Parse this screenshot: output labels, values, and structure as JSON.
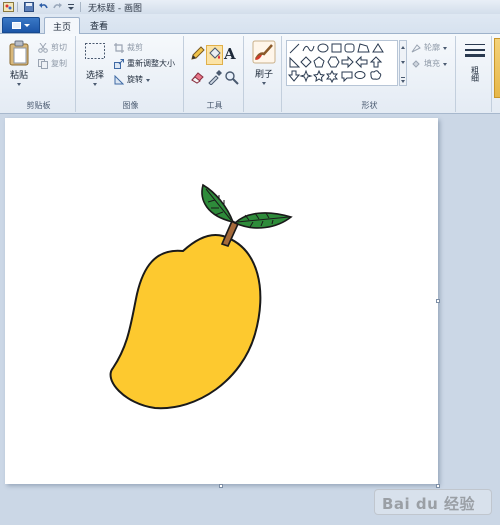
{
  "window": {
    "title": "无标题 - 画图"
  },
  "tabs": [
    {
      "label": "主页",
      "active": true
    },
    {
      "label": "查看",
      "active": false
    }
  ],
  "ribbon": {
    "clipboard": {
      "group_label": "剪贴板",
      "paste_label": "粘贴",
      "cut_label": "剪切",
      "copy_label": "复制"
    },
    "image": {
      "group_label": "图像",
      "select_label": "选择",
      "crop_label": "裁剪",
      "resize_label": "重新调整大小",
      "rotate_label": "旋转"
    },
    "tools": {
      "group_label": "工具",
      "text_tool_glyph": "A"
    },
    "brushes": {
      "label": "刷子"
    },
    "shapes": {
      "group_label": "形状",
      "outline_label": "轮廓",
      "fill_label": "填充"
    },
    "size": {
      "label": "粗细"
    }
  },
  "colors": {
    "mango_fill": "#fdc92f",
    "leaf_fill": "#2e8b3a",
    "stem_fill": "#a56a3a",
    "outline": "#1a1a1a",
    "canvas_bg": "#ffffff"
  },
  "watermark": {
    "text": "Bai du 经验"
  }
}
